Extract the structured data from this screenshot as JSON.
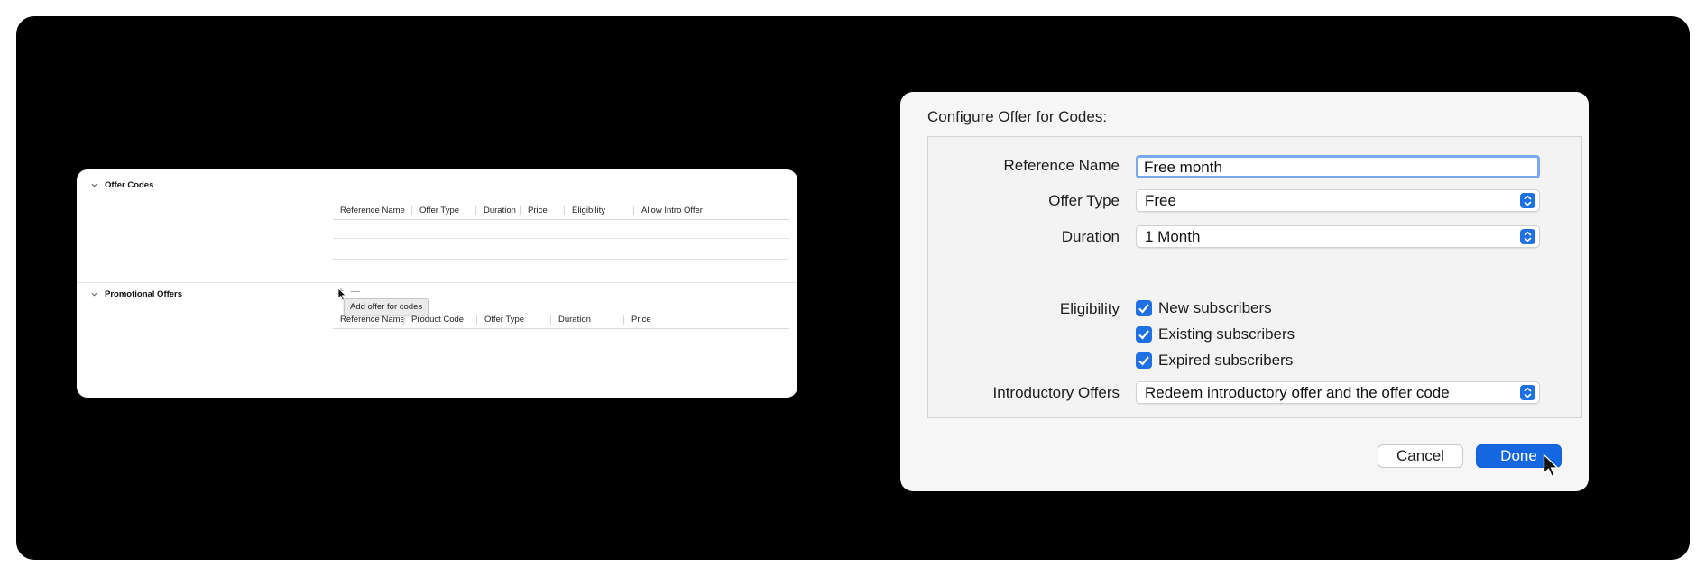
{
  "left_panel": {
    "offer_codes": {
      "title": "Offer Codes",
      "columns": [
        "Reference Name",
        "Offer Type",
        "Duration",
        "Price",
        "Eligibility",
        "Allow Intro Offer"
      ],
      "add_symbol": "+",
      "remove_symbol": "—",
      "tooltip": "Add offer for codes"
    },
    "promotional_offers": {
      "title": "Promotional Offers",
      "columns": [
        "Reference Name",
        "Product Code",
        "Offer Type",
        "Duration",
        "Price"
      ]
    }
  },
  "dialog": {
    "title": "Configure Offer for Codes:",
    "reference_name": {
      "label": "Reference Name",
      "value": "Free month"
    },
    "offer_type": {
      "label": "Offer Type",
      "value": "Free"
    },
    "duration": {
      "label": "Duration",
      "value": "1 Month"
    },
    "eligibility": {
      "label": "Eligibility",
      "options": [
        {
          "label": "New subscribers",
          "checked": true
        },
        {
          "label": "Existing subscribers",
          "checked": true
        },
        {
          "label": "Expired subscribers",
          "checked": true
        }
      ]
    },
    "introductory_offers": {
      "label": "Introductory Offers",
      "value": "Redeem introductory offer and the offer code"
    },
    "cancel_label": "Cancel",
    "done_label": "Done"
  },
  "colors": {
    "accent": "#1f6fe5",
    "done_button": "#1467e0",
    "focus_ring": "#7aa8f0",
    "background": "#000000"
  }
}
